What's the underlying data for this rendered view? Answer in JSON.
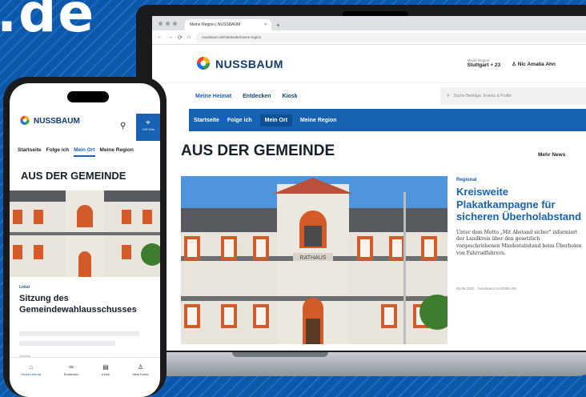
{
  "brand_domain": ".de",
  "laptop": {
    "browser": {
      "tab_title": "Meine Region | NUSSBAUM",
      "url": "nussbaum.de/startseite/meine-region",
      "nav_glyphs": [
        "←",
        "→",
        "⟳",
        "⌂"
      ]
    },
    "site": {
      "logo": "NUSSBAUM",
      "region_label": "Meine Region",
      "region_value": "Stuttgart + 23",
      "user": "Nic Amalia Ahn",
      "subnav": [
        "Meine Heimat",
        "Entdecken",
        "Kiosk"
      ],
      "search_placeholder": "Suche Beiträge, Events & Profile",
      "bluebar": [
        "Startseite",
        "Folge ich",
        "Mein Ort",
        "Meine Region"
      ],
      "bluebar_active": "Mein Ort",
      "section_title": "AUS DER GEMEINDE",
      "more_link": "Mehr News",
      "article": {
        "kicker": "Regional",
        "headline": "Kreisweite Plakatkampagne für sicheren Überholabstand",
        "teaser": "Unter dem Motto „Mit Abstand sicher\" informiert der Landkreis über den gesetzlich vorgeschriebenen Mindestabstand beim Überholen von Fahrradfahrern.",
        "meta": "06.06.2023 · Nussbaum NUSSBAUM",
        "building_sign": "RATHAUS"
      }
    }
  },
  "phone": {
    "logo": "NUSSBAUM",
    "pin_label": "+23 Orte",
    "nav": [
      "Startseite",
      "Folge ich",
      "Mein Ort",
      "Meine Region"
    ],
    "nav_active": "Mein Ort",
    "section_title": "AUS DER GEMEINDE",
    "article": {
      "kicker": "Lokal",
      "headline": "Sitzung des Gemeindewahlausschusses",
      "meta": "Gestern"
    },
    "tabs": [
      {
        "label": "Meine Heimat",
        "icon": "home-icon"
      },
      {
        "label": "Entdecken",
        "icon": "binoculars-icon"
      },
      {
        "label": "Kiosk",
        "icon": "newspaper-icon"
      },
      {
        "label": "Mein Konto",
        "icon": "user-icon"
      }
    ]
  },
  "colors": {
    "accent": "#1762b3",
    "background": "#0d58a8",
    "logo_text": "#123a6b"
  }
}
